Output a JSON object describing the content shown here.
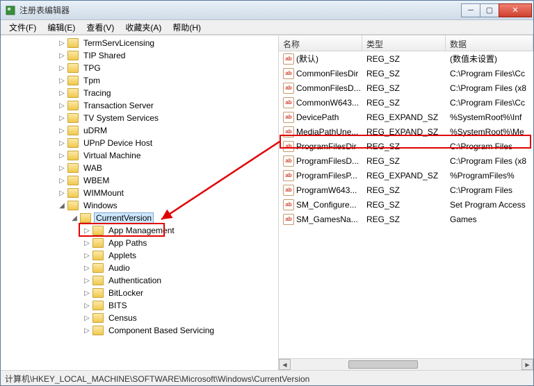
{
  "window": {
    "title": "注册表编辑器"
  },
  "menu": {
    "file": "文件(F)",
    "edit": "编辑(E)",
    "view": "查看(V)",
    "favorites": "收藏夹(A)",
    "help": "帮助(H)"
  },
  "tree": {
    "top_items": [
      "TermServLicensing",
      "TIP Shared",
      "TPG",
      "Tpm",
      "Tracing",
      "Transaction Server",
      "TV System Services",
      "uDRM",
      "UPnP Device Host",
      "Virtual Machine",
      "WAB",
      "WBEM",
      "WIMMount"
    ],
    "windows": "Windows",
    "current_version": "CurrentVersion",
    "cv_children": [
      "App Management",
      "App Paths",
      "Applets",
      "Audio",
      "Authentication",
      "BitLocker",
      "BITS",
      "Census",
      "Component Based Servicing"
    ]
  },
  "list": {
    "headers": {
      "name": "名称",
      "type": "类型",
      "data": "数据"
    },
    "default_label": "(默认)",
    "default_data": "(数值未设置)",
    "rows": [
      {
        "name": "(默认)",
        "type": "REG_SZ",
        "data": "(数值未设置)"
      },
      {
        "name": "CommonFilesDir",
        "type": "REG_SZ",
        "data": "C:\\Program Files\\Cc"
      },
      {
        "name": "CommonFilesD...",
        "type": "REG_SZ",
        "data": "C:\\Program Files (x8"
      },
      {
        "name": "CommonW643...",
        "type": "REG_SZ",
        "data": "C:\\Program Files\\Cc"
      },
      {
        "name": "DevicePath",
        "type": "REG_EXPAND_SZ",
        "data": "%SystemRoot%\\Inf"
      },
      {
        "name": "MediaPathUne...",
        "type": "REG_EXPAND_SZ",
        "data": "%SystemRoot%\\Me"
      },
      {
        "name": "ProgramFilesDir",
        "type": "REG_SZ",
        "data": "C:\\Program Files"
      },
      {
        "name": "ProgramFilesD...",
        "type": "REG_SZ",
        "data": "C:\\Program Files (x8"
      },
      {
        "name": "ProgramFilesP...",
        "type": "REG_EXPAND_SZ",
        "data": "%ProgramFiles%"
      },
      {
        "name": "ProgramW643...",
        "type": "REG_SZ",
        "data": "C:\\Program Files"
      },
      {
        "name": "SM_Configure...",
        "type": "REG_SZ",
        "data": "Set Program Access"
      },
      {
        "name": "SM_GamesNa...",
        "type": "REG_SZ",
        "data": "Games"
      }
    ]
  },
  "status": {
    "path": "计算机\\HKEY_LOCAL_MACHINE\\SOFTWARE\\Microsoft\\Windows\\CurrentVersion"
  }
}
